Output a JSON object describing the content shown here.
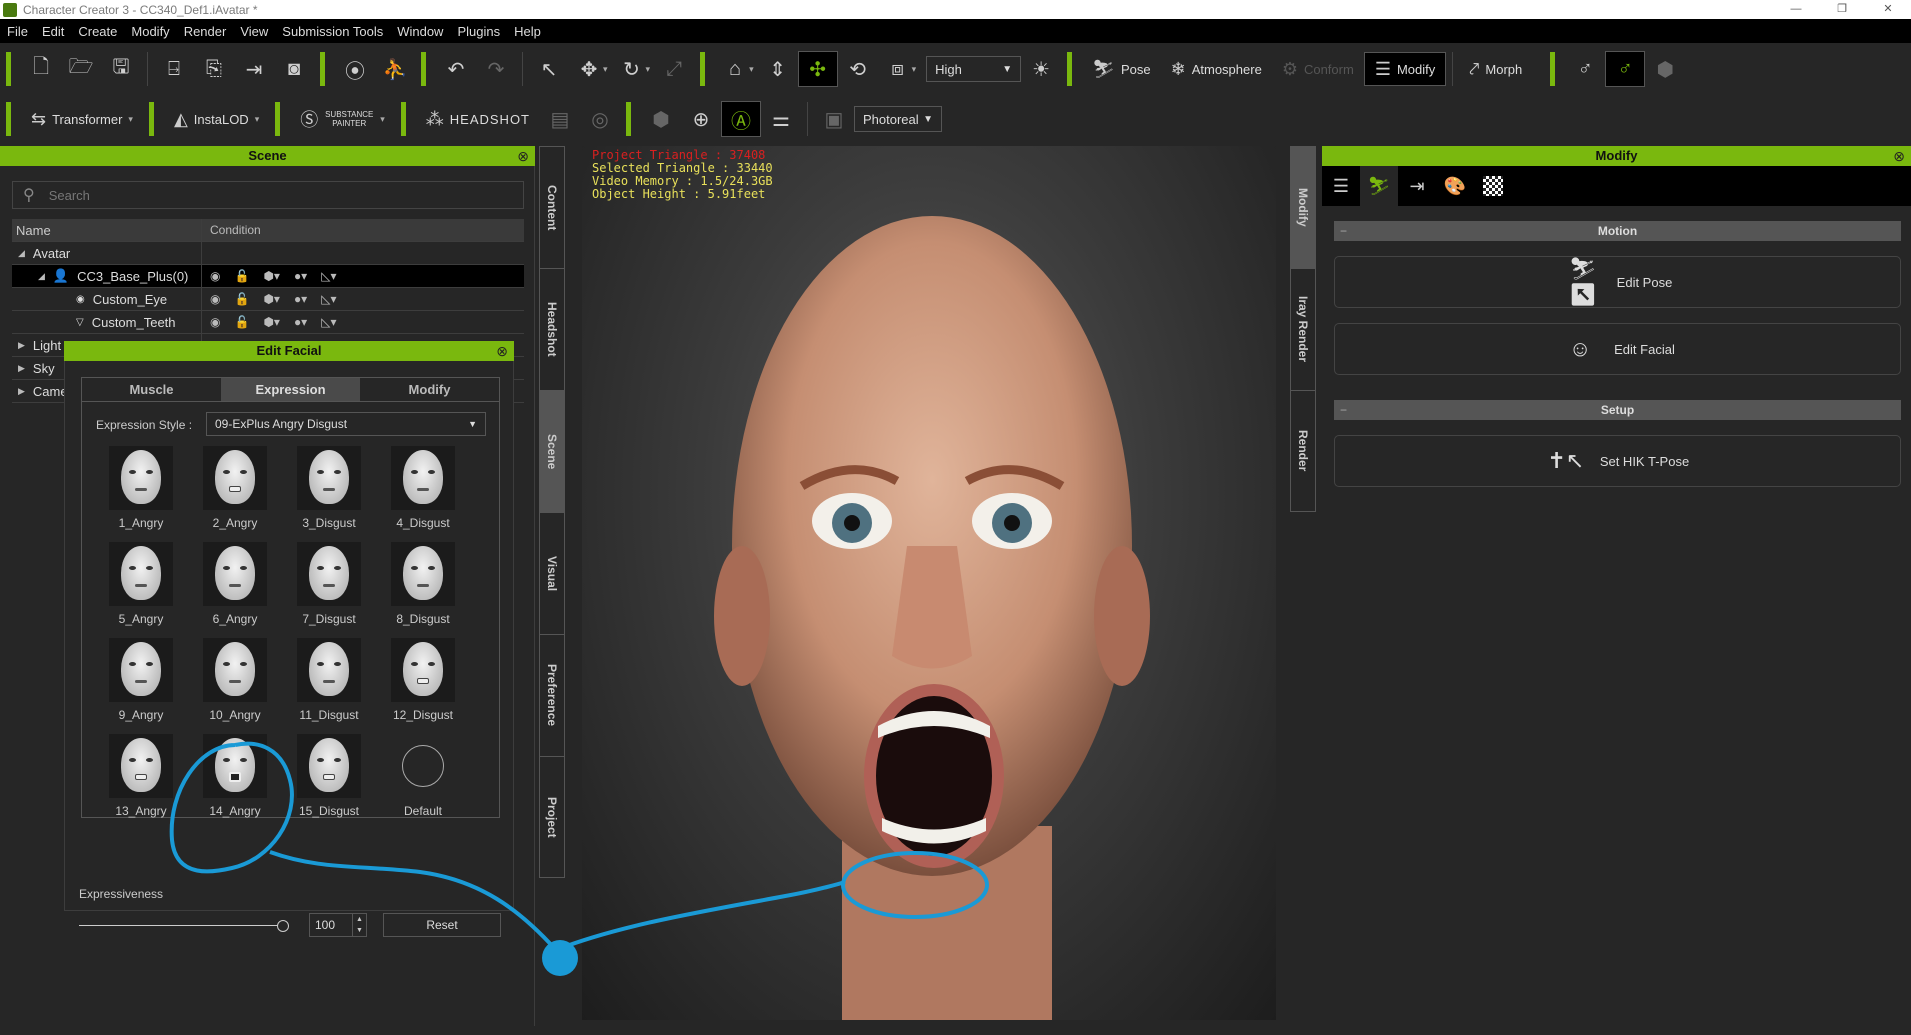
{
  "window": {
    "title": "Character Creator 3 - CC340_Def1.iAvatar *",
    "controls": [
      "—",
      "❐",
      "✕"
    ]
  },
  "menu": [
    "File",
    "Edit",
    "Create",
    "Modify",
    "Render",
    "View",
    "Submission Tools",
    "Window",
    "Plugins",
    "Help"
  ],
  "toolbar1": {
    "quality_select": "High",
    "pose_label": "Pose",
    "atmosphere_label": "Atmosphere",
    "conform_label": "Conform",
    "modify_label": "Modify",
    "morph_label": "Morph"
  },
  "toolbar2": {
    "transformer_label": "Transformer",
    "instalod_label": "InstaLOD",
    "substance_label": "SUBSTANCE PAINTER",
    "headshot_label": "HEADSHOT",
    "render_select": "Photoreal"
  },
  "scene": {
    "title": "Scene",
    "search_placeholder": "Search",
    "columns": [
      "Name",
      "Condition"
    ],
    "rows": [
      {
        "name": "Avatar",
        "level": 0,
        "expanded": true
      },
      {
        "name": "CC3_Base_Plus(0)",
        "level": 1,
        "expanded": true,
        "selected": true
      },
      {
        "name": "Custom_Eye",
        "level": 2
      },
      {
        "name": "Custom_Teeth",
        "level": 2
      },
      {
        "name": "Light",
        "level": 0
      },
      {
        "name": "Sky",
        "level": 0
      },
      {
        "name": "Camera",
        "level": 0
      }
    ]
  },
  "left_tabs": [
    "Content",
    "Headshot",
    "Scene",
    "Visual",
    "Preference",
    "Project"
  ],
  "left_tabs_active": "Scene",
  "right_tabs": [
    "Modify",
    "Iray Render",
    "Render"
  ],
  "right_tabs_active": "Modify",
  "viewport": {
    "project_triangle": "Project Triangle : 37408",
    "selected_triangle": "Selected Triangle : 33440",
    "video_memory": "Video Memory : 1.5/24.3GB",
    "object_height": "Object Height : 5.91feet"
  },
  "edit_facial": {
    "title": "Edit Facial",
    "tabs": [
      "Muscle",
      "Expression",
      "Modify"
    ],
    "active_tab": "Expression",
    "style_label": "Expression Style :",
    "style_value": "09-ExPlus Angry Disgust",
    "expressions": [
      {
        "label": "1_Angry",
        "mouth": "closed"
      },
      {
        "label": "2_Angry",
        "mouth": "teeth"
      },
      {
        "label": "3_Disgust",
        "mouth": "closed"
      },
      {
        "label": "4_Disgust",
        "mouth": "closed"
      },
      {
        "label": "5_Angry",
        "mouth": "closed"
      },
      {
        "label": "6_Angry",
        "mouth": "closed"
      },
      {
        "label": "7_Disgust",
        "mouth": "closed"
      },
      {
        "label": "8_Disgust",
        "mouth": "closed"
      },
      {
        "label": "9_Angry",
        "mouth": "closed"
      },
      {
        "label": "10_Angry",
        "mouth": "closed"
      },
      {
        "label": "11_Disgust",
        "mouth": "closed"
      },
      {
        "label": "12_Disgust",
        "mouth": "teeth"
      },
      {
        "label": "13_Angry",
        "mouth": "teeth"
      },
      {
        "label": "14_Angry",
        "mouth": "open"
      },
      {
        "label": "15_Disgust",
        "mouth": "teeth"
      },
      {
        "label": "Default",
        "mouth": "none"
      }
    ],
    "expressiveness_label": "Expressiveness",
    "expressiveness_value": "100",
    "expressiveness_fraction": 1.0,
    "reset_label": "Reset"
  },
  "modify_panel": {
    "title": "Modify",
    "sections": [
      {
        "title": "Motion",
        "buttons": [
          {
            "label": "Edit Pose",
            "icon": "edit-pose-icon"
          },
          {
            "label": "Edit Facial",
            "icon": "edit-facial-icon"
          }
        ]
      },
      {
        "title": "Setup",
        "buttons": [
          {
            "label": "Set HIK T-Pose",
            "icon": "t-pose-icon"
          }
        ]
      }
    ]
  },
  "annotation_color": "#1a9ad6",
  "accent_color": "#7ab80e"
}
